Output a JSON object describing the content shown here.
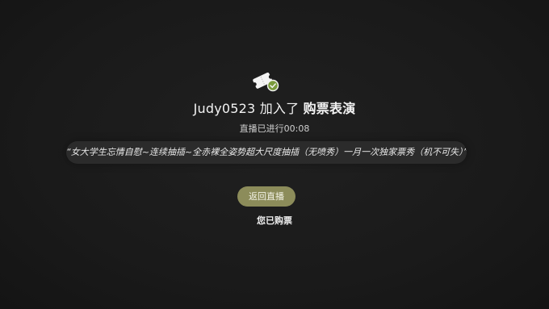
{
  "join": {
    "username": "Judy0523",
    "action": "加入了",
    "target": "购票表演",
    "icon": "ticket-badge-icon",
    "icon_accent": "#7a9a3c"
  },
  "live_status": "直播已进行00:08",
  "show_name": "“女大学生忘情自慰~连续抽插~全赤裸全姿势超大尺度抽插（无喷秀）一月一次独家票秀（机不可失）”",
  "buttons": {
    "return_live": "返回直播",
    "return_color": "#8c8c5a"
  },
  "purchased_text": "您已购票"
}
